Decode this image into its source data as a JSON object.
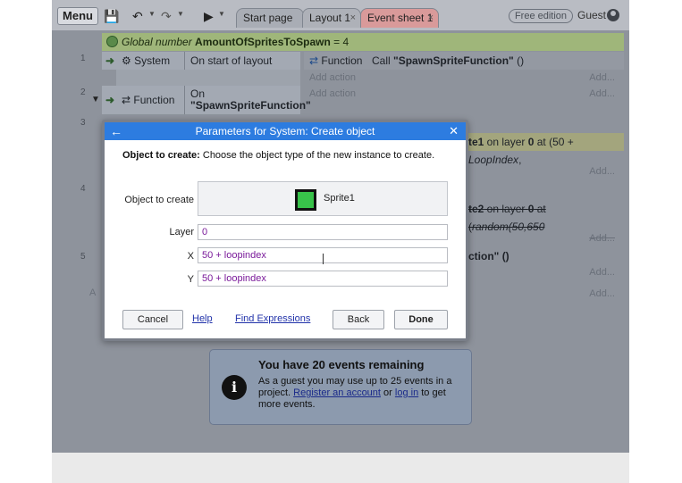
{
  "toolbar": {
    "menu_label": "Menu",
    "tabs": [
      {
        "label": "Start page"
      },
      {
        "label": "Layout 1",
        "close": "×"
      },
      {
        "label": "Event sheet 1",
        "close": "×"
      }
    ],
    "free_edition": "Free edition",
    "guest_label": "Guest"
  },
  "sheet": {
    "global_var": {
      "prefix": "Global number ",
      "name": "AmountOfSpritesToSpawn",
      "suffix": " = 4"
    },
    "events": [
      {
        "num": "1",
        "cond_object": "System",
        "cond_text": "On start of layout",
        "action_object": "Function",
        "action_call": "Call ",
        "action_name": "\"SpawnSpriteFunction\"",
        "action_args": " ()",
        "add_action": "Add action",
        "add": "Add..."
      },
      {
        "num": "2",
        "cond_object": "Function",
        "cond_text_1": "On",
        "cond_text_2": "\"SpawnSpriteFunction\"",
        "add_action": "Add action",
        "add": "Add..."
      },
      {
        "num": "3",
        "action_fragment_bold": "te1",
        "action_fragment_1": " on layer ",
        "action_fragment_layer": "0",
        "action_fragment_2": " at (50 + ",
        "action_fragment_italic": "LoopIndex",
        "action_fragment_3": ",",
        "add": "Add..."
      },
      {
        "num": "4",
        "action_fragment_bold": "te2",
        "action_fragment_1": " on layer ",
        "action_fragment_layer": "0",
        "action_fragment_2": " at (",
        "action_fragment_italic": "random(50,650",
        "add": "Add..."
      },
      {
        "num": "5",
        "action_fragment_1": "ction\" ()",
        "add": "Add...",
        "add_2": "Add..."
      }
    ],
    "left_fragment": "A"
  },
  "dialog": {
    "title": "Parameters for System: Create object",
    "back_icon": "←",
    "close_icon": "✕",
    "desc_bold": "Object to create:",
    "desc_text": " Choose the object type of the new instance to create.",
    "object_label": "Object to create",
    "object_value": "Sprite1",
    "layer_label": "Layer",
    "layer_value": "0",
    "x_label": "X",
    "x_value": "50 + loopindex",
    "y_label": "Y",
    "y_value": "50 + loopindex",
    "cancel": "Cancel",
    "help": "Help",
    "find_expressions": "Find Expressions",
    "back": "Back",
    "done": "Done"
  },
  "notice": {
    "title": "You have 20 events remaining",
    "line1": "As a guest you may use up to 25 events in a",
    "line2_pre": "project. ",
    "register": "Register an account",
    "line2_mid": " or ",
    "login": "log in",
    "line2_post": " to get",
    "line3": "more events.",
    "icon": "i"
  }
}
